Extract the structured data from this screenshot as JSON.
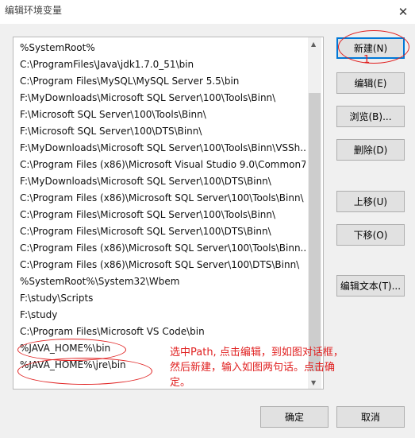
{
  "window": {
    "title": "编辑环境变量",
    "close_glyph": "✕"
  },
  "paths": [
    "%SystemRoot%",
    "C:\\ProgramFiles\\Java\\jdk1.7.0_51\\bin",
    "C:\\Program Files\\MySQL\\MySQL Server 5.5\\bin",
    "F:\\MyDownloads\\Microsoft SQL Server\\100\\Tools\\Binn\\",
    "F:\\Microsoft SQL Server\\100\\Tools\\Binn\\",
    "F:\\Microsoft SQL Server\\100\\DTS\\Binn\\",
    "F:\\MyDownloads\\Microsoft SQL Server\\100\\Tools\\Binn\\VSSh...",
    "C:\\Program Files (x86)\\Microsoft Visual Studio 9.0\\Common7...",
    "F:\\MyDownloads\\Microsoft SQL Server\\100\\DTS\\Binn\\",
    "C:\\Program Files (x86)\\Microsoft SQL Server\\100\\Tools\\Binn\\",
    "C:\\Program Files\\Microsoft SQL Server\\100\\Tools\\Binn\\",
    "C:\\Program Files\\Microsoft SQL Server\\100\\DTS\\Binn\\",
    "C:\\Program Files (x86)\\Microsoft SQL Server\\100\\Tools\\Binn...",
    "C:\\Program Files (x86)\\Microsoft SQL Server\\100\\DTS\\Binn\\",
    "%SystemRoot%\\System32\\Wbem",
    "F:\\study\\Scripts",
    "F:\\study",
    "C:\\Program Files\\Microsoft VS Code\\bin",
    "%JAVA_HOME%\\bin",
    "%JAVA_HOME%\\jre\\bin"
  ],
  "buttons": {
    "new": "新建(N)",
    "edit": "编辑(E)",
    "browse": "浏览(B)...",
    "delete": "删除(D)",
    "move_up": "上移(U)",
    "move_down": "下移(O)",
    "edit_text": "编辑文本(T)...",
    "ok": "确定",
    "cancel": "取消"
  },
  "annotation": {
    "step_number": "1",
    "note_lines": [
      "选中Path, 点击编辑，到如图对话框，",
      "然后新建，输入如图两句话。点击确",
      "定。"
    ],
    "color": "#e02020"
  }
}
